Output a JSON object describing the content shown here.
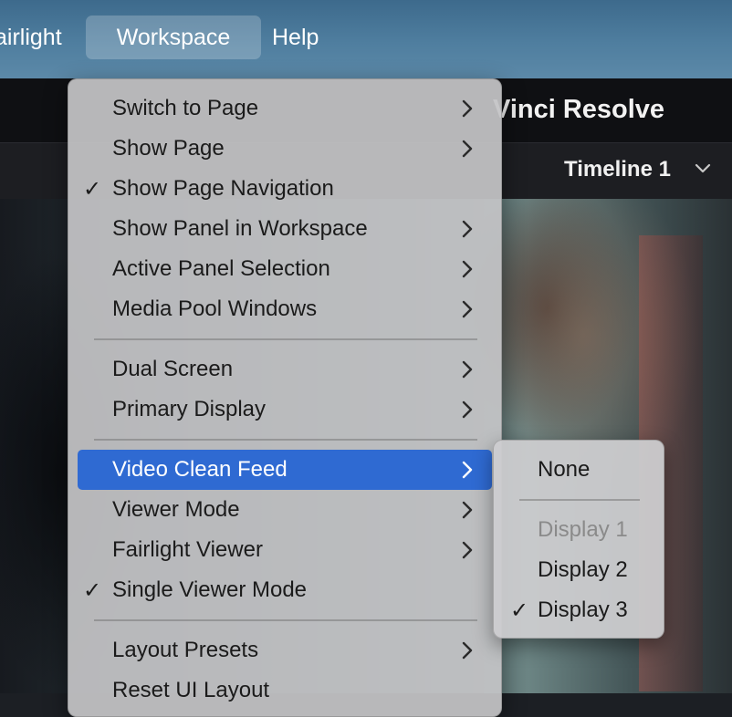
{
  "menubar": {
    "items": [
      "airlight",
      "Workspace",
      "Help"
    ]
  },
  "window": {
    "title": "Vinci Resolve",
    "timeline": "Timeline 1"
  },
  "menu": {
    "items": [
      {
        "label": "Switch to Page",
        "submenu": true
      },
      {
        "label": "Show Page",
        "submenu": true
      },
      {
        "label": "Show Page Navigation",
        "checked": true
      },
      {
        "label": "Show Panel in Workspace",
        "submenu": true
      },
      {
        "label": "Active Panel Selection",
        "submenu": true
      },
      {
        "label": "Media Pool Windows",
        "submenu": true
      },
      {
        "label": "Dual Screen",
        "submenu": true
      },
      {
        "label": "Primary Display",
        "submenu": true
      },
      {
        "label": "Video Clean Feed",
        "submenu": true,
        "highlighted": true
      },
      {
        "label": "Viewer Mode",
        "submenu": true
      },
      {
        "label": "Fairlight Viewer",
        "submenu": true
      },
      {
        "label": "Single Viewer Mode",
        "checked": true
      },
      {
        "label": "Layout Presets",
        "submenu": true
      },
      {
        "label": "Reset UI Layout"
      }
    ],
    "check_glyph": "✓"
  },
  "submenu": {
    "items": [
      {
        "label": "None"
      },
      {
        "label": "Display 1",
        "disabled": true
      },
      {
        "label": "Display 2"
      },
      {
        "label": "Display 3",
        "checked": true
      }
    ]
  },
  "colors": {
    "highlight": "#2f6ad2",
    "menu_bg": "#c4c4c6",
    "menubar_bg": "#4f7e9f"
  },
  "icons": {
    "submenu_arrow": "chevron-right-icon",
    "checkmark": "checkmark-icon",
    "dropdown": "chevron-down-icon"
  }
}
